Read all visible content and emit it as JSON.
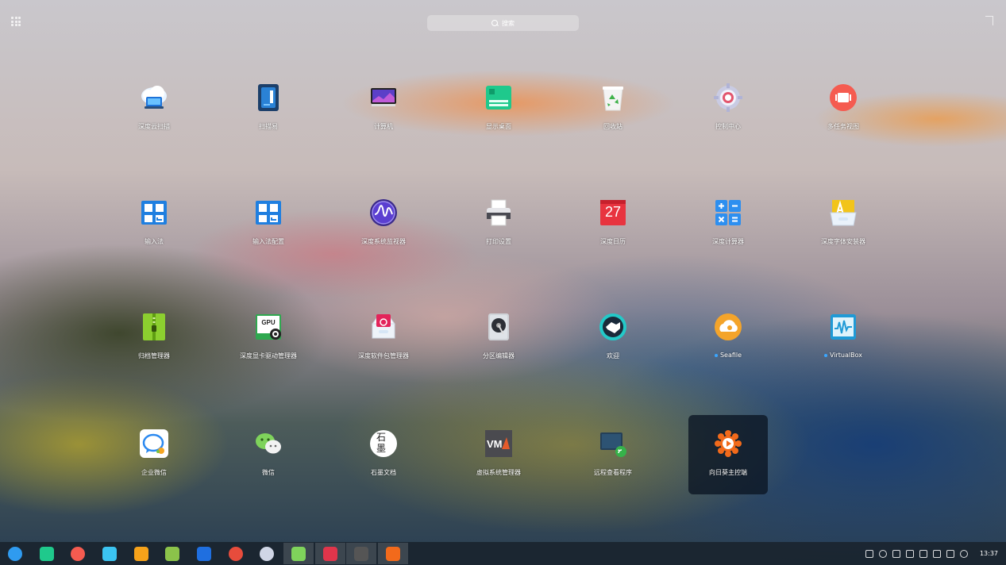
{
  "search": {
    "placeholder": "搜索"
  },
  "apps": [
    {
      "label": "深度云扫描",
      "icon": "cloud-scanner-icon"
    },
    {
      "label": "扫描易",
      "icon": "scanner-icon"
    },
    {
      "label": "计算机",
      "icon": "computer-icon"
    },
    {
      "label": "显示桌面",
      "icon": "show-desktop-icon"
    },
    {
      "label": "回收站",
      "icon": "trash-icon"
    },
    {
      "label": "控制中心",
      "icon": "control-center-icon"
    },
    {
      "label": "多任务视图",
      "icon": "multitask-view-icon"
    },
    {
      "label": "输入法",
      "icon": "input-method-icon"
    },
    {
      "label": "输入法配置",
      "icon": "input-method-config-icon"
    },
    {
      "label": "深度系统监视器",
      "icon": "system-monitor-icon"
    },
    {
      "label": "打印设置",
      "icon": "printer-icon"
    },
    {
      "label": "深度日历",
      "icon": "calendar-icon",
      "day": "27"
    },
    {
      "label": "深度计算器",
      "icon": "calculator-icon"
    },
    {
      "label": "深度字体安装器",
      "icon": "font-installer-icon"
    },
    {
      "label": "归档管理器",
      "icon": "archive-manager-icon"
    },
    {
      "label": "深度显卡驱动管理器",
      "icon": "gpu-driver-manager-icon",
      "badge": "GPU"
    },
    {
      "label": "深度软件包管理器",
      "icon": "package-manager-icon"
    },
    {
      "label": "分区编辑器",
      "icon": "partition-editor-icon"
    },
    {
      "label": "欢迎",
      "icon": "welcome-icon"
    },
    {
      "label": "Seafile",
      "icon": "seafile-icon",
      "new": true
    },
    {
      "label": "VirtualBox",
      "icon": "virtualbox-icon",
      "new": true
    },
    {
      "label": "企业微信",
      "icon": "wecom-icon"
    },
    {
      "label": "微信",
      "icon": "wechat-icon"
    },
    {
      "label": "石墨文档",
      "icon": "shimo-docs-icon",
      "glyph": "石墨"
    },
    {
      "label": "虚拟系统管理器",
      "icon": "virt-manager-icon",
      "glyph": "VM"
    },
    {
      "label": "远程查看程序",
      "icon": "remote-viewer-icon"
    },
    {
      "label": "向日葵主控端",
      "icon": "sunlogin-icon",
      "selected": true
    }
  ],
  "dock": [
    {
      "name": "launcher-icon",
      "color": "#2f9bf0"
    },
    {
      "name": "show-desktop-icon",
      "color": "#1fc98c"
    },
    {
      "name": "multitask-view-icon",
      "color": "#f55b50"
    },
    {
      "name": "app-store-icon",
      "color": "#3bc4f2"
    },
    {
      "name": "archive-icon",
      "color": "#f6a21a"
    },
    {
      "name": "music-icon",
      "color": "#8bc34a"
    },
    {
      "name": "video-icon",
      "color": "#1f6fe0"
    },
    {
      "name": "chrome-icon",
      "color": "#e74c3c"
    },
    {
      "name": "settings-icon",
      "color": "#d0d6e6"
    },
    {
      "name": "wechat-icon",
      "color": "#7fd35b"
    },
    {
      "name": "terminal-icon",
      "color": "#e0354b"
    },
    {
      "name": "virt-manager-icon",
      "color": "#555555"
    },
    {
      "name": "sunlogin-icon",
      "color": "#f26a1b"
    }
  ],
  "tray": {
    "icons": [
      "usb-icon",
      "wechat-tray-icon",
      "keyboard-icon",
      "volume-icon",
      "wifi-icon",
      "pen-icon",
      "battery-icon",
      "power-icon"
    ],
    "time": "13:37"
  }
}
